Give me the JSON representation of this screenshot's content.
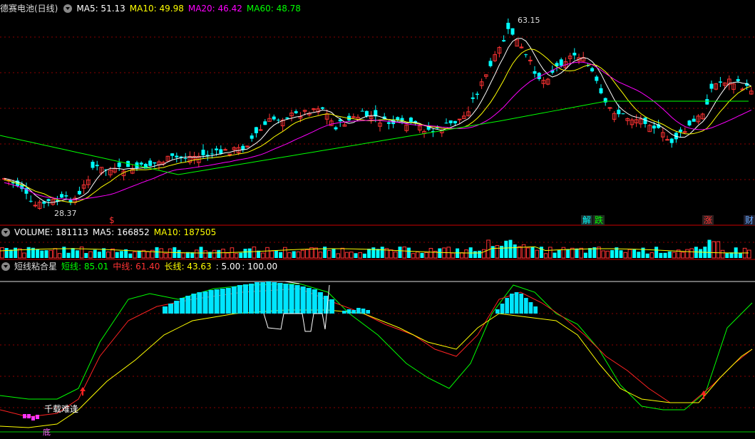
{
  "stock": {
    "title": "德赛电池(日线)",
    "ma": [
      {
        "label": "MA5: 51.13",
        "color": "#ffffff"
      },
      {
        "label": "MA10: 49.98",
        "color": "#ffff00"
      },
      {
        "label": "MA20: 46.42",
        "color": "#ff00ff"
      },
      {
        "label": "MA60: 48.78",
        "color": "#00ff00"
      }
    ],
    "high_label": "63.15",
    "low_label": "28.37"
  },
  "volume": {
    "items": [
      {
        "label": "VOLUME: 181113",
        "color": "#ffffff"
      },
      {
        "label": "MA5: 166852",
        "color": "#ffffff"
      },
      {
        "label": "MA10: 187505",
        "color": "#ffff00"
      }
    ]
  },
  "indicator": {
    "title": "短线粘合星",
    "items": [
      {
        "label": "短线: 85.01",
        "color": "#00ff00"
      },
      {
        "label": "中线: 61.40",
        "color": "#ff3333"
      },
      {
        "label": "长线: 43.63",
        "color": "#ffff00"
      },
      {
        "label": ": 5.00",
        "color": "#ffffff"
      },
      {
        "label": ": 100.00",
        "color": "#ffffff"
      }
    ],
    "tag_text": "千载难逢",
    "bottom_tag": "底"
  },
  "events": [
    {
      "text": "$",
      "color": "#ff3333",
      "bg": "transparent"
    },
    {
      "text": "解",
      "color": "#00ffff",
      "bg": "#203030"
    },
    {
      "text": "跌",
      "color": "#00ff00",
      "bg": "#203020"
    },
    {
      "text": "涨",
      "color": "#ff3333",
      "bg": "#302020"
    },
    {
      "text": "财",
      "color": "#66aaff",
      "bg": "#202030"
    }
  ],
  "colors": {
    "up": "#ff3333",
    "down": "#00ffff",
    "grid": "#8b0000"
  }
}
